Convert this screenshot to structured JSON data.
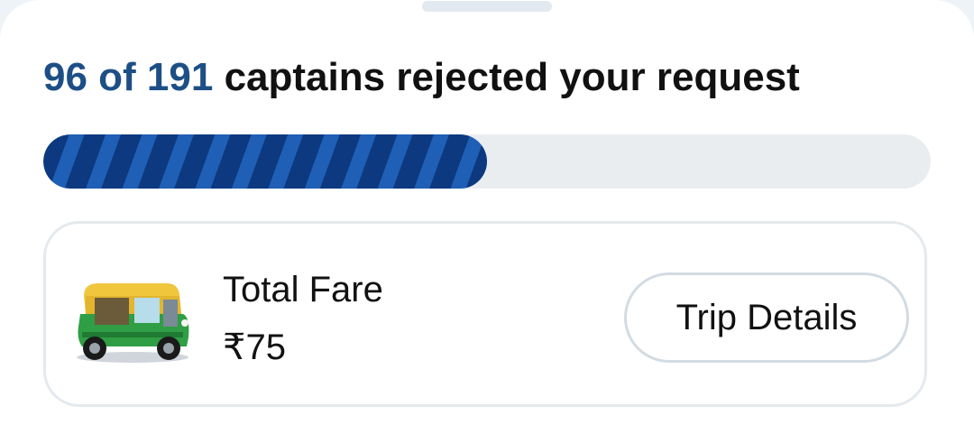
{
  "status": {
    "rejected_count_text": "96 of 191",
    "message_text": "captains rejected your request",
    "rejected": 96,
    "total": 191,
    "progress_fraction": 0.5
  },
  "fare": {
    "label": "Total Fare",
    "amount": "₹75",
    "vehicle_icon": "auto-rickshaw-icon"
  },
  "actions": {
    "trip_details_label": "Trip Details"
  },
  "colors": {
    "accent_text": "#1d4f86",
    "progress_dark": "#0d3980",
    "progress_light": "#1f5fb6",
    "track": "#eaedf0"
  }
}
